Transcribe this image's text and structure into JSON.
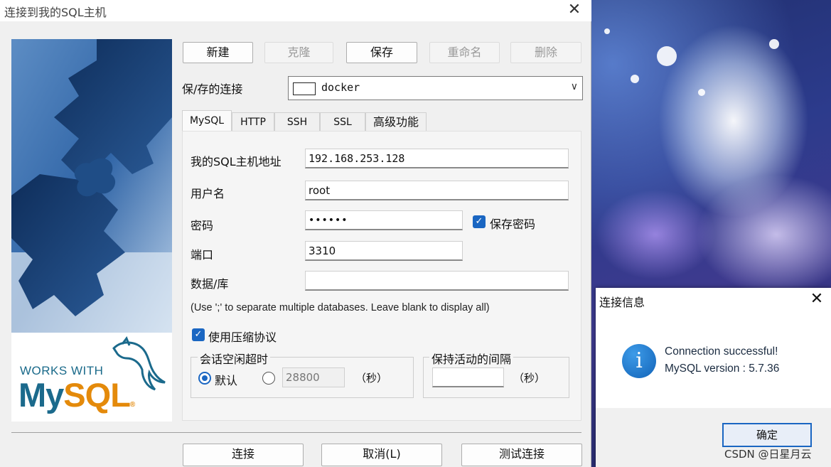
{
  "main_window": {
    "title": "连接到我的SQL主机",
    "close_glyph": "✕"
  },
  "side_panel": {
    "logo_top": "WORKS WITH",
    "logo_mysql_a": "My",
    "logo_mysql_b": "SQL",
    "logo_reg": "®"
  },
  "toolbar": {
    "new": "新建",
    "clone": "克隆",
    "save": "保存",
    "rename": "重命名",
    "delete": "删除"
  },
  "saved_connection": {
    "label": "保/存的连接",
    "value": "docker",
    "chevron": "∨"
  },
  "tabs": [
    "MySQL",
    "HTTP",
    "SSH",
    "SSL",
    "高级功能"
  ],
  "form": {
    "host_label": "我的SQL主机地址",
    "host_value": "192.168.253.128",
    "user_label": "用户名",
    "user_value": "root",
    "password_label": "密码",
    "password_value": "••••••",
    "save_password_label": "保存密码",
    "port_label": "端口",
    "port_value": "3310",
    "database_label": "数据/库",
    "database_value": "",
    "hint": "(Use ';' to separate multiple databases. Leave blank to display all)",
    "compression_label": "使用压缩协议"
  },
  "session_timeout": {
    "title": "会话空闲超时",
    "default_label": "默认",
    "custom_value": "28800",
    "unit": "（秒）"
  },
  "keepalive": {
    "title": "保持活动的间隔",
    "value": "",
    "unit": "（秒）"
  },
  "bottom_buttons": {
    "connect": "连接",
    "cancel": "取消(L)",
    "test": "测试连接"
  },
  "info_dialog": {
    "title": "连接信息",
    "close_glyph": "✕",
    "icon_glyph": "i",
    "line1": "Connection successful!",
    "line2": "MySQL version : 5.7.36",
    "ok": "确定"
  },
  "watermark": "CSDN @日星月云",
  "checkmark": "✓",
  "colors": {
    "accent": "#1a66c2",
    "mysql_blue": "#1b6a8c",
    "mysql_orange": "#e48a0b"
  }
}
